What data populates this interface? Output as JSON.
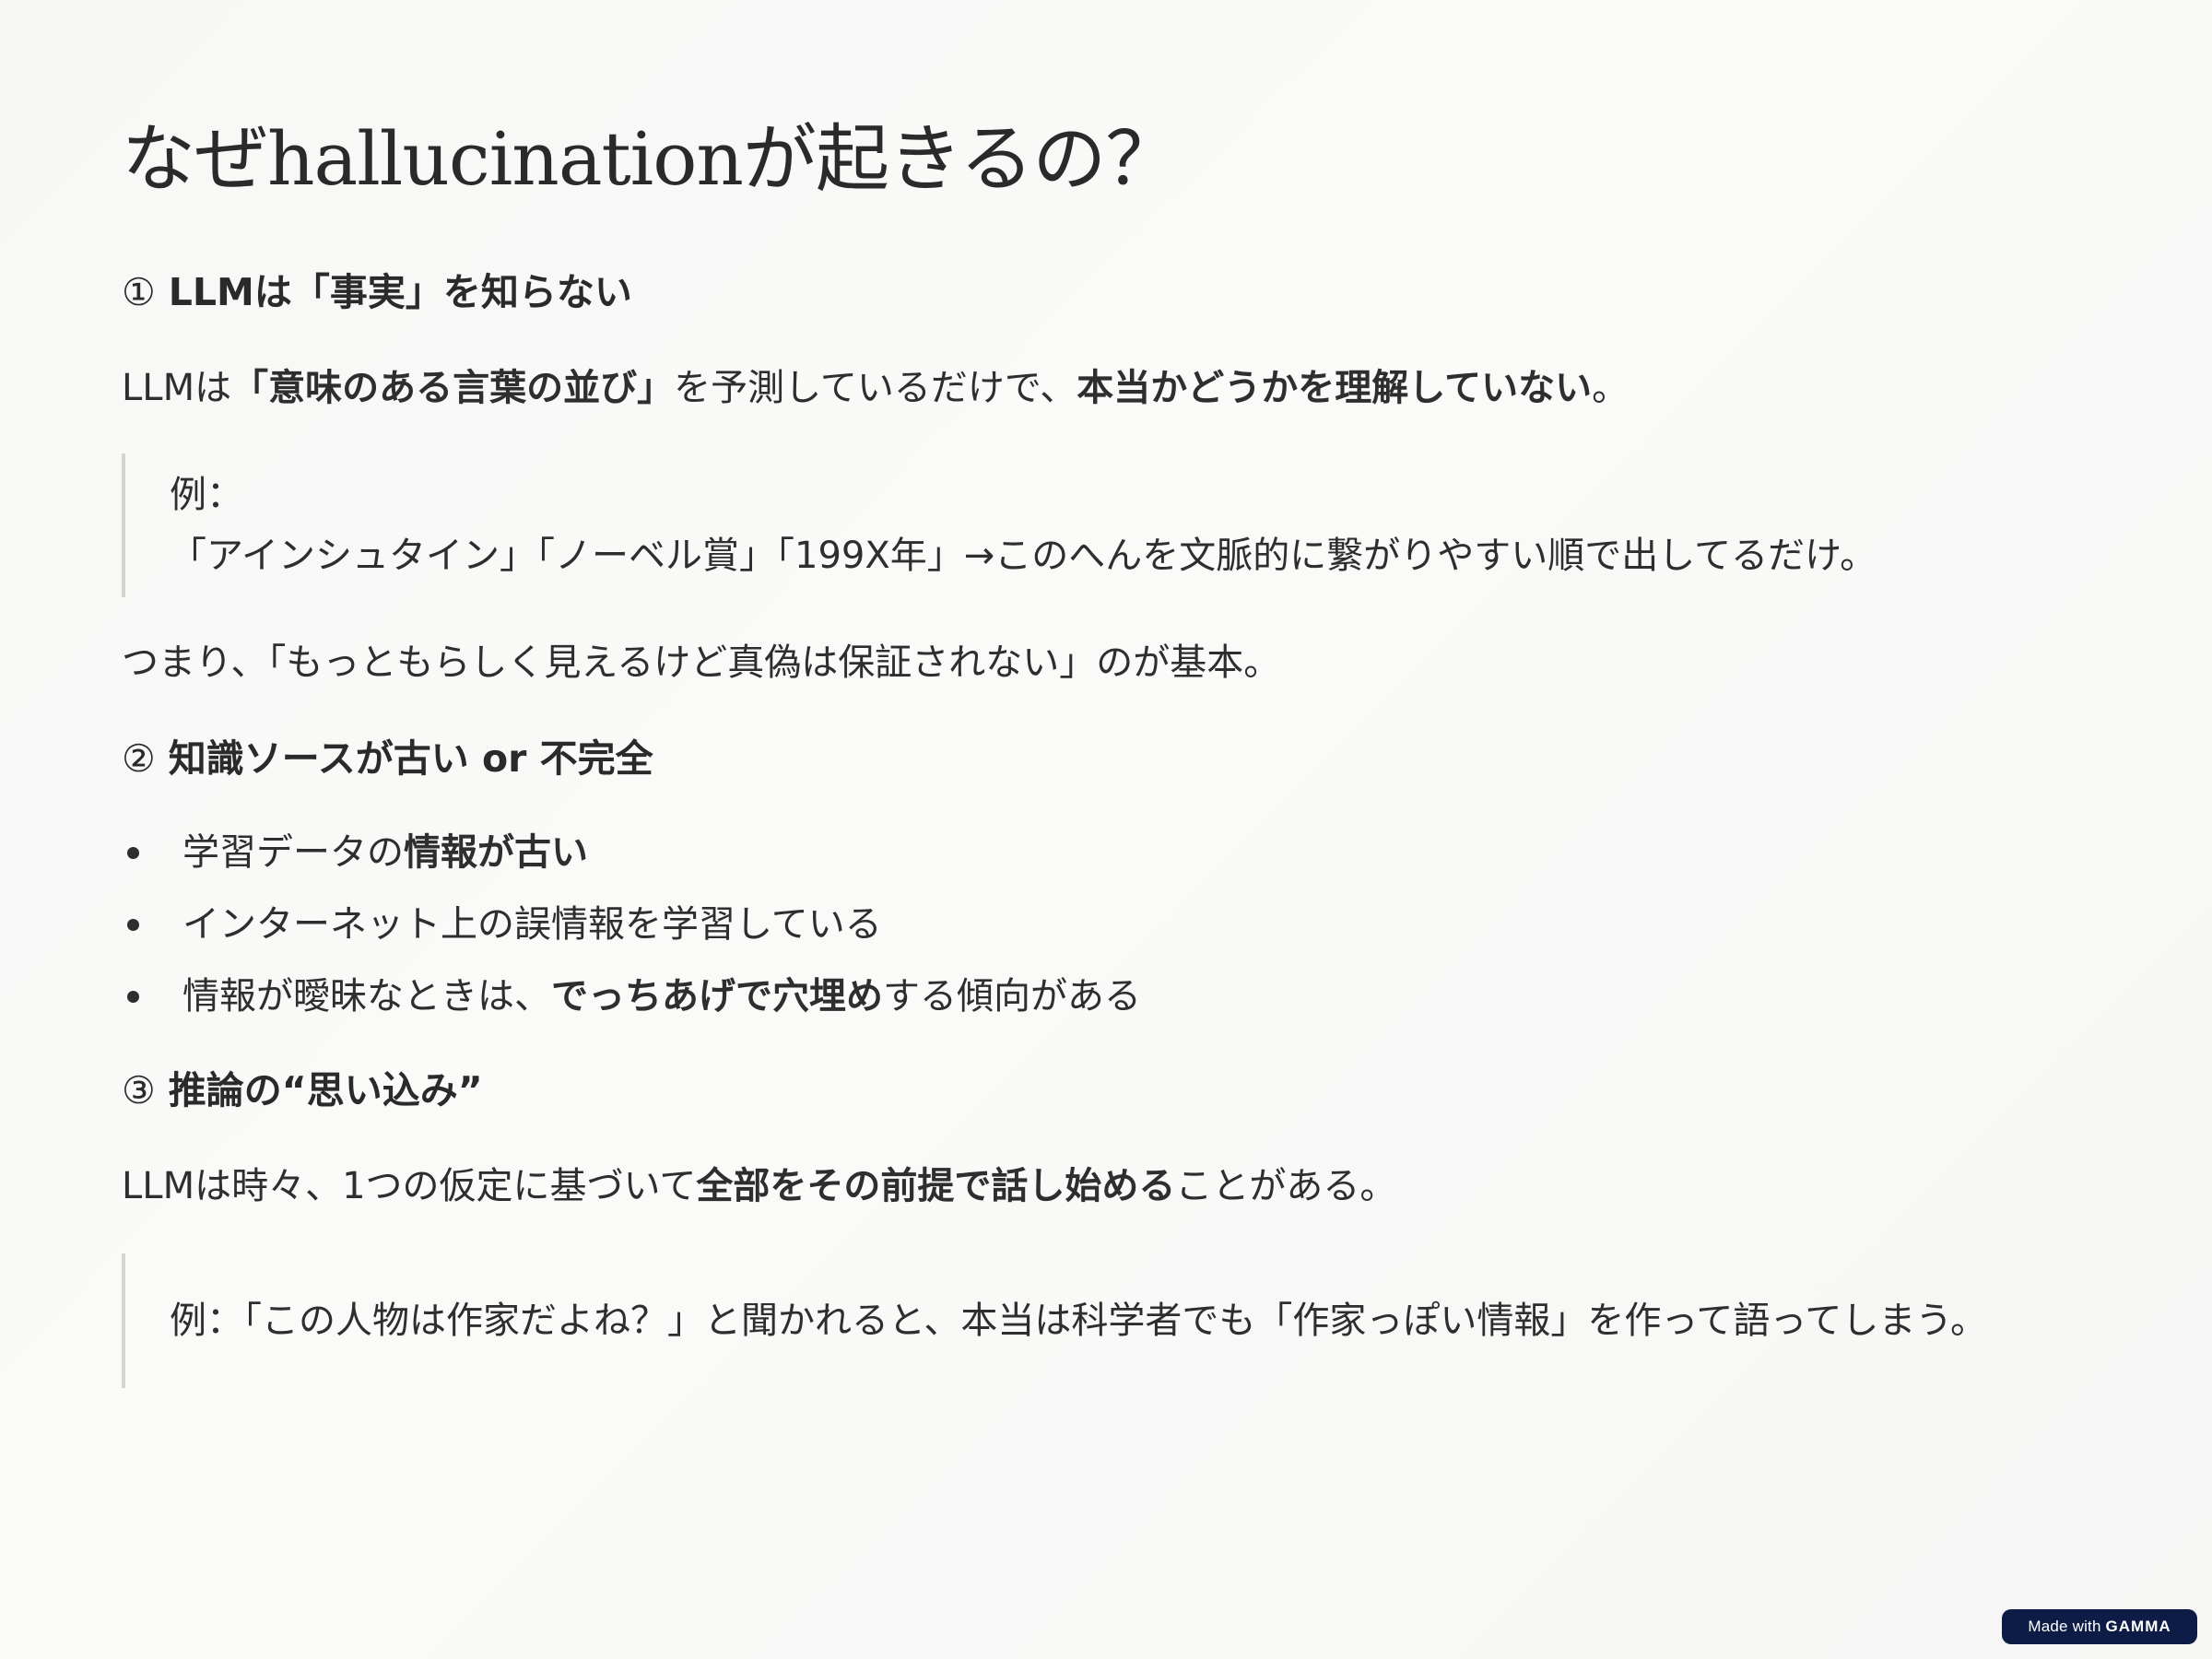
{
  "title": "なぜhallucinationが起きるの？",
  "section1": {
    "number": "①",
    "heading": "LLMは「事実」を知らない",
    "para": {
      "t1": "LLMは",
      "b1": "「意味のある言葉の並び」",
      "t2": "を予測しているだけで、",
      "b2": "本当かどうかを理解していない",
      "t3": "。"
    },
    "quote": {
      "line1": "例：",
      "line2": "「アインシュタイン」「ノーベル賞」「199X年」→このへんを文脈的に繋がりやすい順で出してるだけ。"
    },
    "conclusion": "つまり、「もっともらしく見えるけど真偽は保証されない」のが基本。"
  },
  "section2": {
    "number": "②",
    "heading": "知識ソースが古い or 不完全",
    "bullets": [
      {
        "t1": "学習データの",
        "b1": "情報が古い",
        "t2": ""
      },
      {
        "t1": "インターネット上の誤情報を学習している",
        "b1": "",
        "t2": ""
      },
      {
        "t1": "情報が曖昧なときは、",
        "b1": "でっちあげで穴埋め",
        "t2": "する傾向がある"
      }
    ]
  },
  "section3": {
    "number": "③",
    "heading": "推論の“思い込み”",
    "para": {
      "t1": "LLMは時々、1つの仮定に基づいて",
      "b1": "全部をその前提で話し始める",
      "t2": "ことがある。"
    },
    "quote": {
      "line1": "例：「この人物は作家だよね？」と聞かれると、本当は科学者でも「作家っぽい情報」を作って語ってしまう。"
    }
  },
  "badge": {
    "prefix": "Made with ",
    "brand": "GAMMA"
  }
}
